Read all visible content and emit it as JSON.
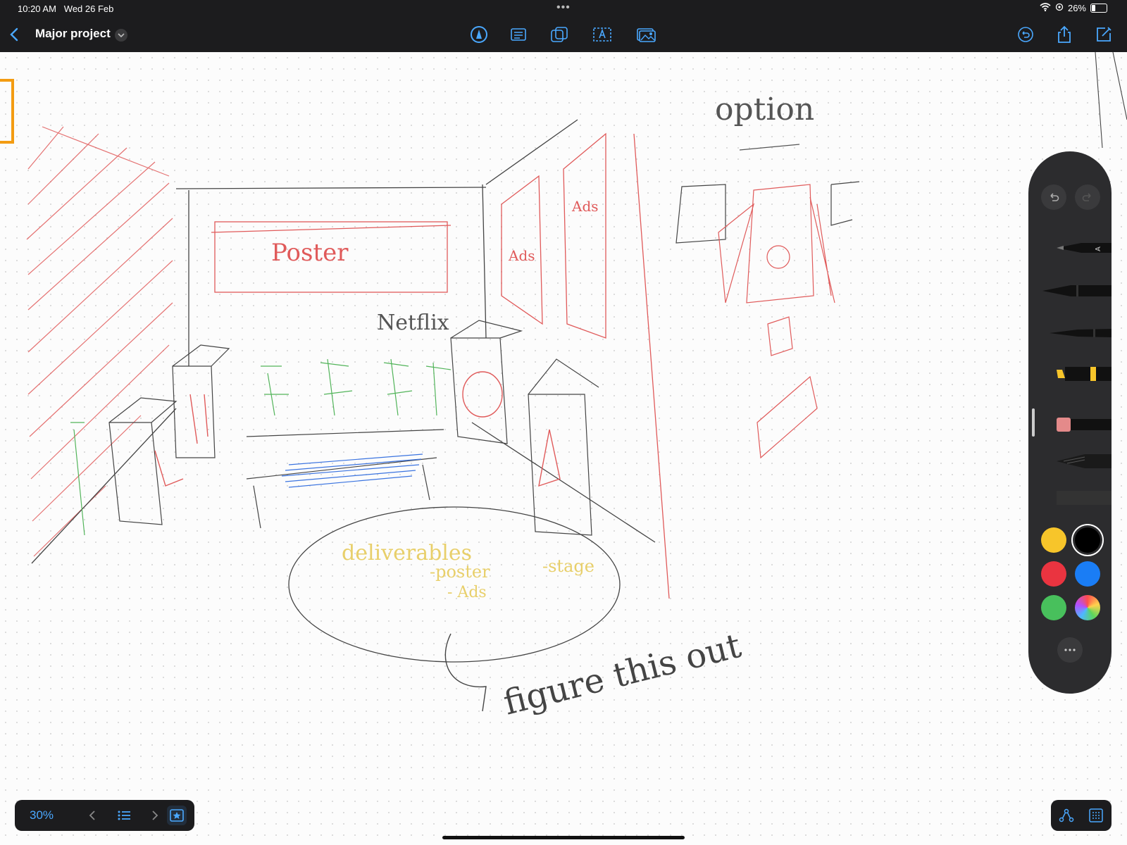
{
  "status_bar": {
    "time": "10:20 AM",
    "date": "Wed 26 Feb",
    "battery": "26%"
  },
  "toolbar": {
    "title": "Major project"
  },
  "canvas": {
    "handwriting": {
      "poster": "Poster",
      "netflix": "Netflix",
      "option": "option",
      "ads_1": "Ads",
      "ads_2": "Ads",
      "deliverables": "deliverables",
      "poster_note": "-poster",
      "ads_note": "- Ads",
      "stage": "-stage",
      "figure_this_out": "figure this out"
    }
  },
  "palette": {
    "colors": [
      "#f7c52a",
      "#000000",
      "#ea3440",
      "#1a7df5",
      "#48c05c"
    ]
  },
  "bottom_bar": {
    "zoom": "30%"
  }
}
